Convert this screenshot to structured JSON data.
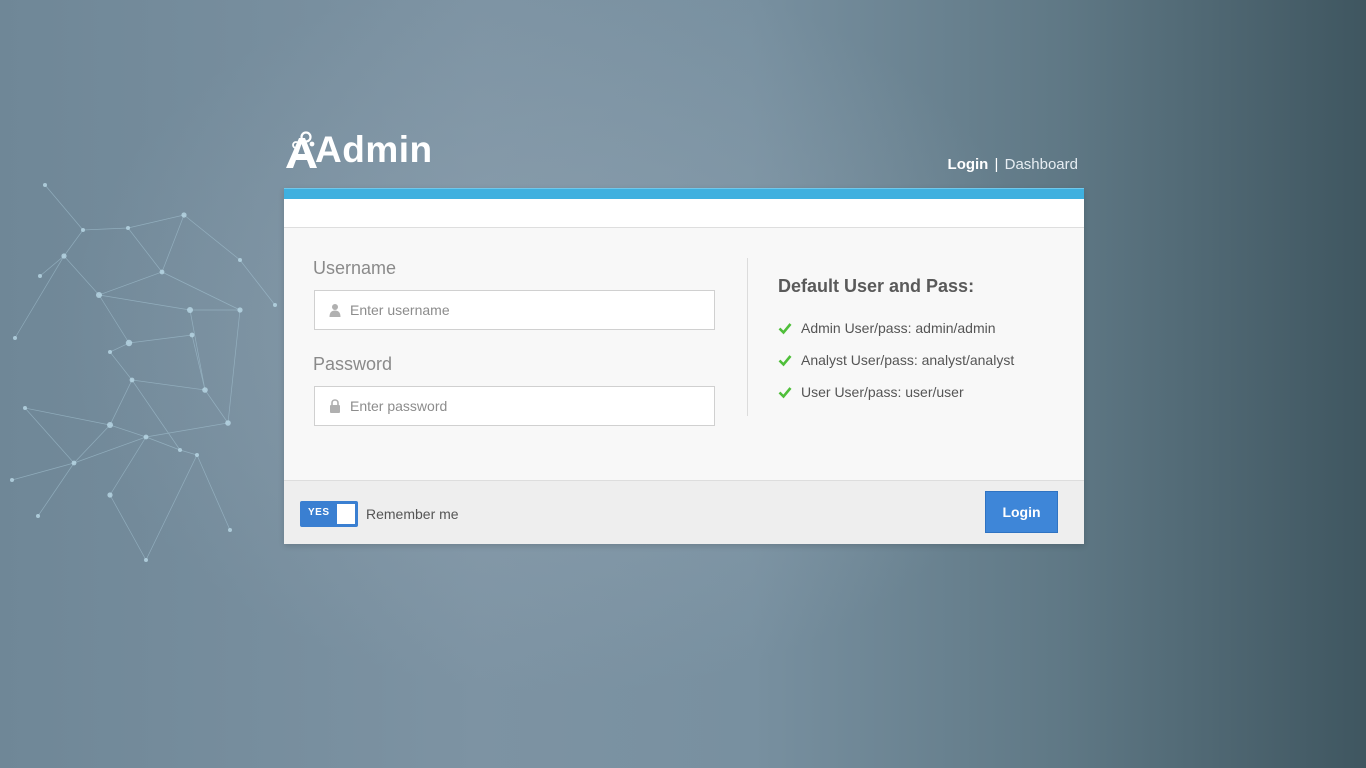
{
  "logo": {
    "text": "Admin"
  },
  "nav": {
    "login": "Login",
    "separator": "|",
    "dashboard": "Dashboard"
  },
  "form": {
    "username_label": "Username",
    "username_placeholder": "Enter username",
    "username_value": "",
    "password_label": "Password",
    "password_placeholder": "Enter password",
    "password_value": ""
  },
  "info": {
    "title": "Default User and Pass:",
    "items": [
      "Admin User/pass: admin/admin",
      "Analyst User/pass: analyst/analyst",
      "User User/pass: user/user"
    ]
  },
  "footer": {
    "toggle_label": "YES",
    "toggle_on": true,
    "remember_label": "Remember me",
    "login_button": "Login"
  },
  "colors": {
    "accent_bar": "#3fb0df",
    "primary_button": "#3e86d8",
    "check": "#4fbf3a"
  },
  "icons": {
    "username": "user-icon",
    "password": "lock-icon",
    "list": "check-icon"
  }
}
